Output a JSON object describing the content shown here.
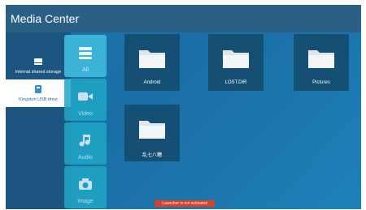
{
  "app": {
    "title": "Media Center"
  },
  "storage": {
    "items": [
      {
        "label": "Internal shared storage",
        "icon": "hard-drive-icon",
        "selected": false
      },
      {
        "label": "Kingston USB drive",
        "icon": "usb-drive-icon",
        "selected": true
      }
    ]
  },
  "categories": {
    "items": [
      {
        "label": "All",
        "icon": "stack-icon",
        "active": true
      },
      {
        "label": "Video",
        "icon": "video-camera-icon",
        "active": false
      },
      {
        "label": "Audio",
        "icon": "music-note-icon",
        "active": false
      },
      {
        "label": "Image",
        "icon": "camera-icon",
        "active": false
      }
    ]
  },
  "files": {
    "items": [
      {
        "name": "Android",
        "icon": "folder-icon"
      },
      {
        "name": "LOST.DIR",
        "icon": "folder-icon"
      },
      {
        "name": "Pictures",
        "icon": "folder-icon"
      },
      {
        "name": "乱七八糟",
        "icon": "folder-icon"
      }
    ]
  },
  "toast": {
    "message": "Launcher is not activated"
  },
  "colors": {
    "background": "#1d77ad",
    "titlebar": "#2a5f86",
    "tile": "#164f74",
    "category_active": "#3bb3d8",
    "toast": "#d9412b"
  }
}
